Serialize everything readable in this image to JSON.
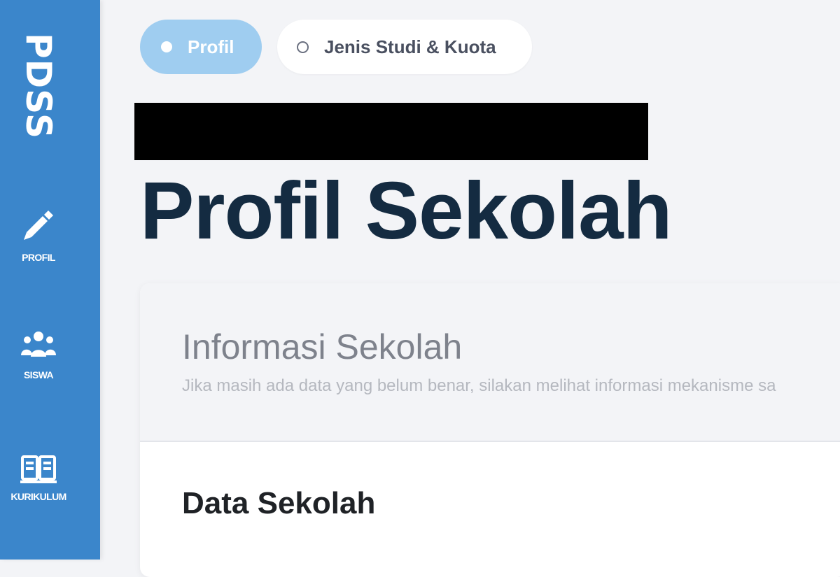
{
  "sidebar": {
    "brand": "PDSS",
    "items": [
      {
        "label": "PROFIL",
        "icon": "pencil-icon"
      },
      {
        "label": "SISWA",
        "icon": "users-icon"
      },
      {
        "label": "KURIKULUM",
        "icon": "book-icon"
      }
    ]
  },
  "tabs": [
    {
      "label": "Profil",
      "active": true
    },
    {
      "label": "Jenis Studi & Kuota",
      "active": false
    }
  ],
  "page": {
    "title": "Profil Sekolah"
  },
  "card": {
    "title": "Informasi Sekolah",
    "subtitle": "Jika masih ada data yang belum benar, silakan melihat informasi mekanisme sa",
    "section_title": "Data Sekolah"
  },
  "colors": {
    "sidebar": "#3b86cb",
    "tab_active": "#9fcdf0",
    "title": "#142b41",
    "background": "#f3f4f7"
  }
}
